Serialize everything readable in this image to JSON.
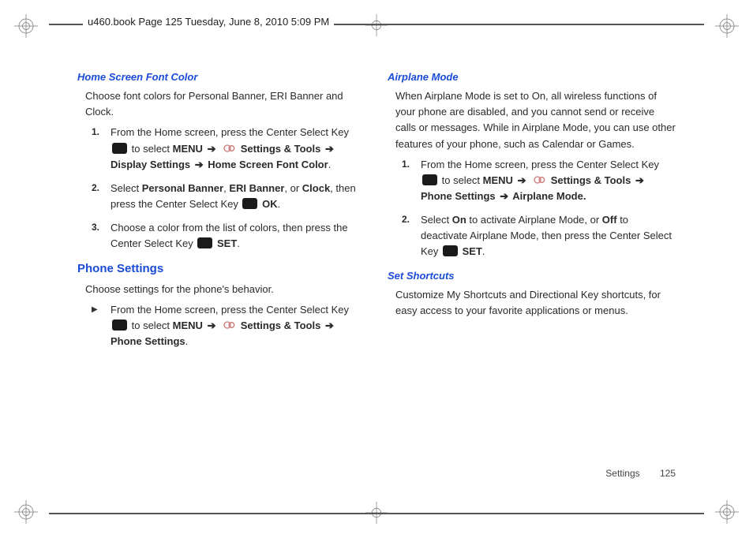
{
  "header": {
    "pageinfo": "u460.book  Page 125  Tuesday, June 8, 2010  5:09 PM"
  },
  "footer": {
    "section": "Settings",
    "page": "125"
  },
  "left": {
    "h1": "Home Screen Font Color",
    "intro1": "Choose font colors for Personal Banner, ERI Banner and Clock.",
    "s1a": "From the Home screen, press the Center Select Key ",
    "s1b": "to select ",
    "menu": "MENU",
    "settingsTools": " Settings & Tools ",
    "displaySettings": "Display Settings ",
    "hsfc": " Home Screen Font Color",
    "s2a": "Select ",
    "pb": "Personal Banner",
    "eri": "ERI Banner",
    "or": ", or ",
    "clock": "Clock",
    "s2b": ", then press the Center Select Key ",
    "ok": " OK",
    "s3a": "Choose a color from the list of colors, then press the Center Select Key ",
    "set": " SET",
    "h2": "Phone Settings",
    "intro2": "Choose settings for the phone's behavior.",
    "b1a": "From the Home screen, press the Center Select Key ",
    "b1b": "to select ",
    "phoneSettings": " Phone Settings"
  },
  "right": {
    "h1": "Airplane Mode",
    "intro1a": "When Airplane Mode is set to On, all wireless functions of your phone are disabled, and you cannot send or receive calls or messages. While in Airplane Mode, you can use other features of your phone, such as Calendar or Games.",
    "s1a": "From the Home screen, press the Center Select Key ",
    "s1b": "to select ",
    "menu": "MENU",
    "settingsTools": " Settings & Tools ",
    "phoneSettings": " Phone Settings ",
    "airplaneMode": " Airplane Mode.",
    "s2a": "Select ",
    "on": "On",
    "s2b": " to activate Airplane Mode, or ",
    "off": "Off",
    "s2c": " to deactivate Airplane Mode, then press the Center Select Key ",
    "set": " SET",
    "h2": "Set Shortcuts",
    "intro2": "Customize My Shortcuts and Directional Key shortcuts, for easy access to your favorite applications or menus."
  }
}
